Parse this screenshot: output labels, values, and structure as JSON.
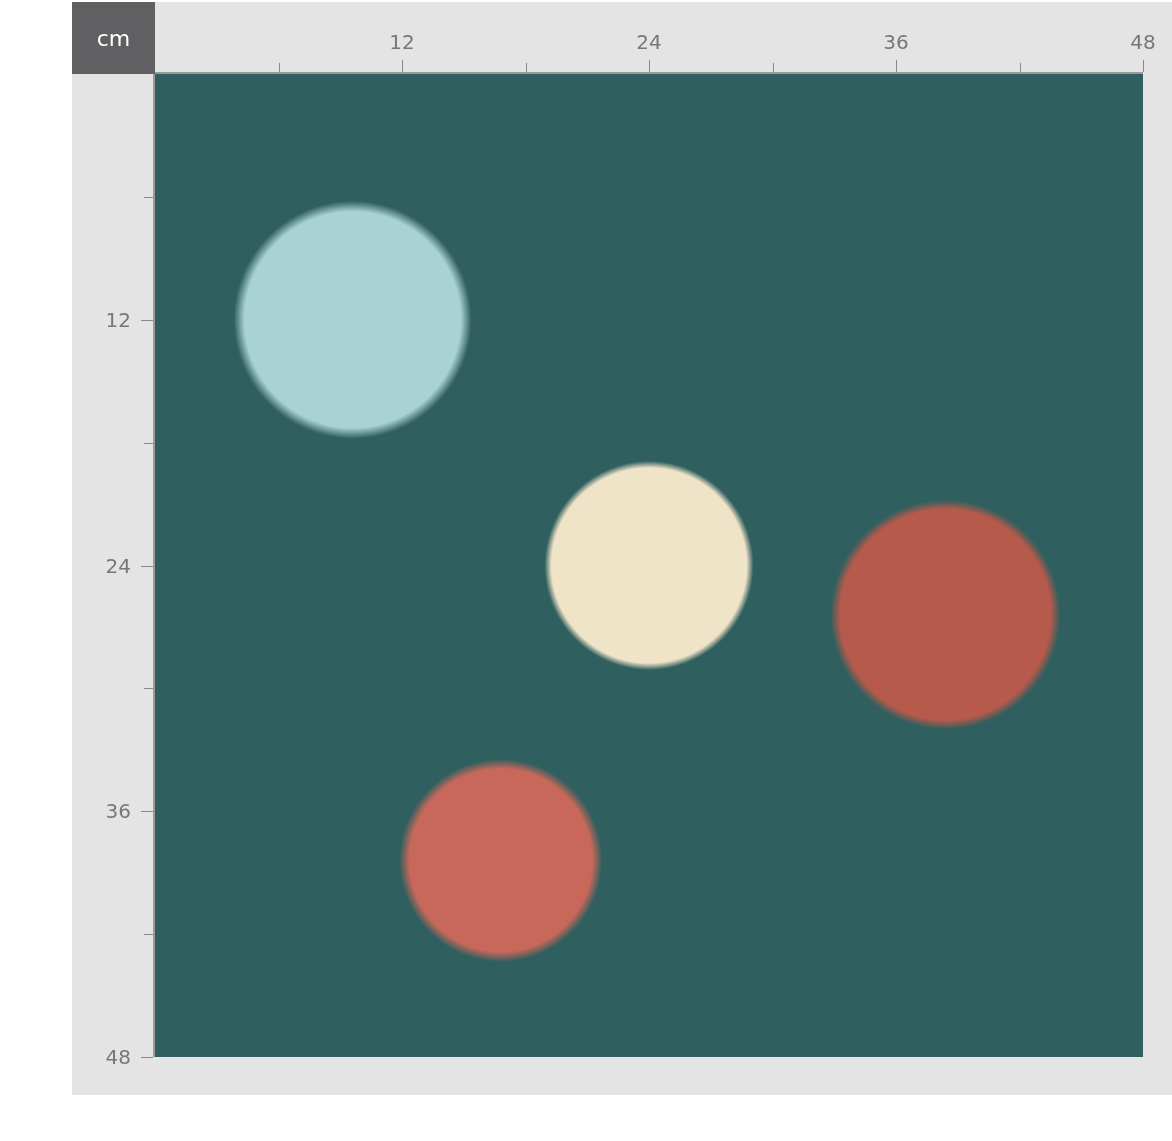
{
  "unit_label": "cm",
  "ruler": {
    "top_labels": [
      "12",
      "24",
      "36",
      "48"
    ],
    "left_labels": [
      "12",
      "24",
      "36",
      "48"
    ]
  }
}
